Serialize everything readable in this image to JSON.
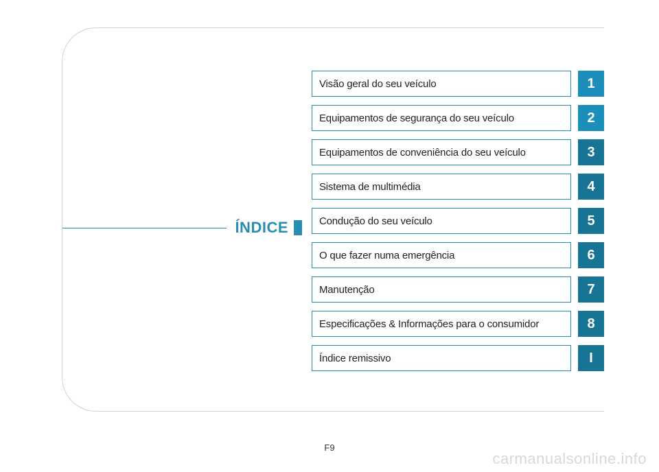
{
  "heading": "ÍNDICE",
  "toc": [
    {
      "label": "Visão geral do seu veículo",
      "num": "1",
      "shade": "light"
    },
    {
      "label": "Equipamentos de segurança do seu veículo",
      "num": "2",
      "shade": "light"
    },
    {
      "label": "Equipamentos de conveniência do seu veículo",
      "num": "3",
      "shade": "dark"
    },
    {
      "label": "Sistema de multimédia",
      "num": "4",
      "shade": "dark"
    },
    {
      "label": "Condução do seu veículo",
      "num": "5",
      "shade": "dark"
    },
    {
      "label": "O que fazer numa emergência",
      "num": "6",
      "shade": "dark"
    },
    {
      "label": "Manutenção",
      "num": "7",
      "shade": "dark"
    },
    {
      "label": "Especificações & Informações para o consumidor",
      "num": "8",
      "shade": "dark"
    },
    {
      "label": "Índice remissivo",
      "num": "I",
      "shade": "dark"
    }
  ],
  "page_number": "F9",
  "watermark": "carmanualsonline.info"
}
